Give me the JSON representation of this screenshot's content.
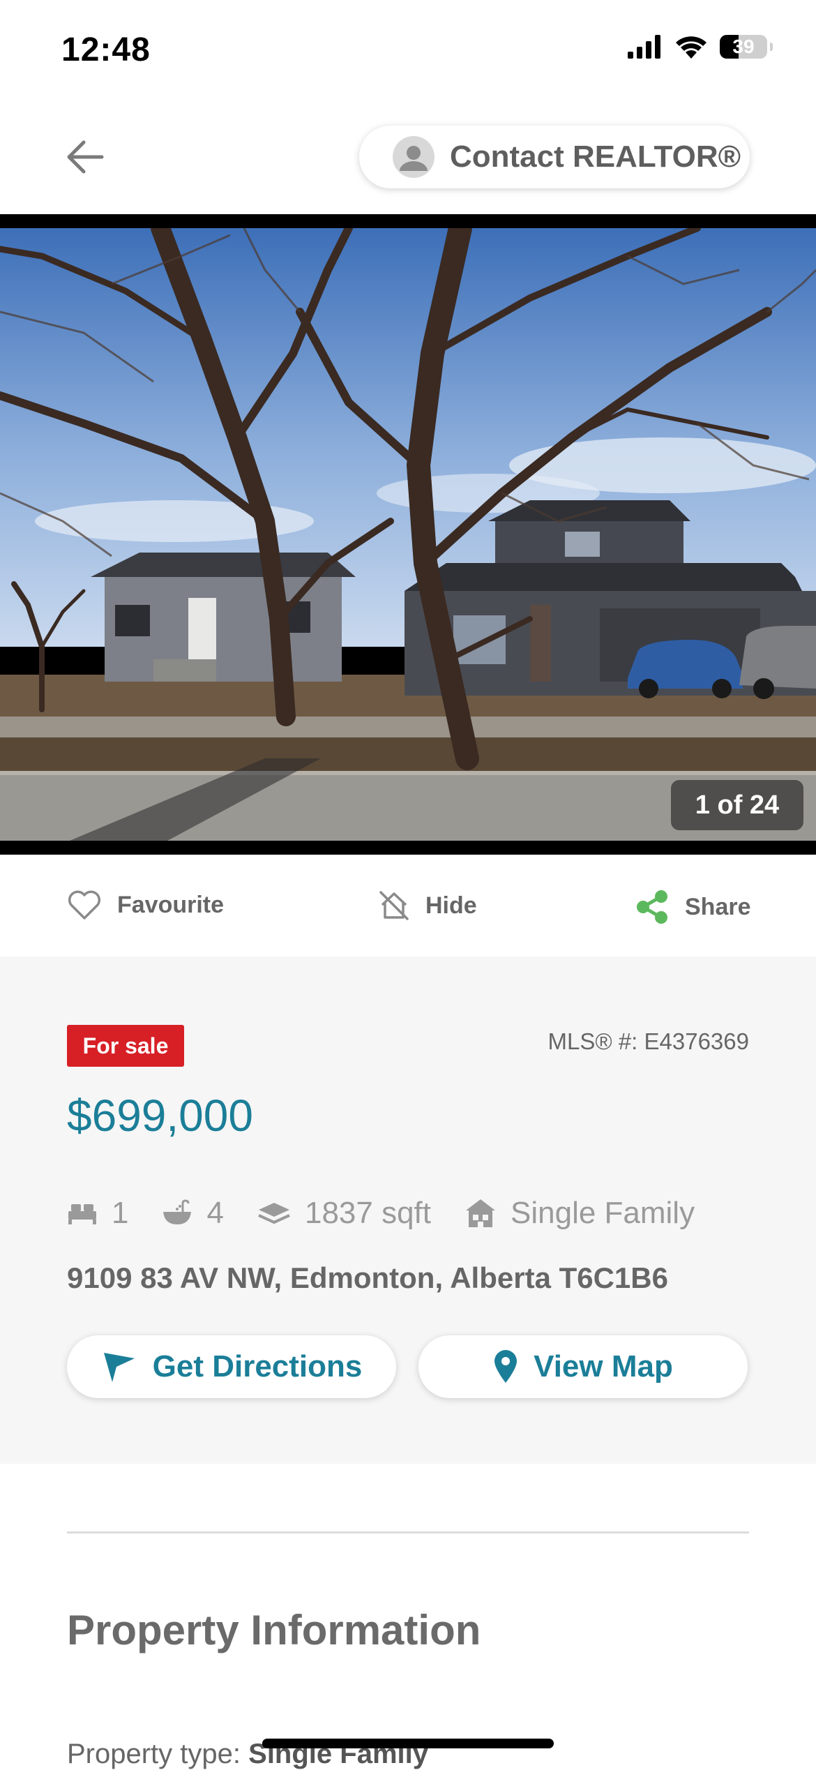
{
  "status_bar": {
    "time": "12:48",
    "battery": "39"
  },
  "nav": {
    "contact_label": "Contact REALTOR®"
  },
  "photo": {
    "counter": "1 of 24"
  },
  "actions": {
    "favourite": "Favourite",
    "hide": "Hide",
    "share": "Share"
  },
  "listing": {
    "status_badge": "For sale",
    "mls": "MLS® #: E4376369",
    "price": "$699,000",
    "bedrooms": "1",
    "bathrooms": "4",
    "size": "1837 sqft",
    "building_type": "Single Family",
    "address": "9109 83 AV NW, Edmonton, Alberta T6C1B6"
  },
  "buttons": {
    "directions": "Get Directions",
    "map": "View Map"
  },
  "section": {
    "title": "Property Information",
    "property_type_label": "Property type:",
    "property_type_value": "Single Family"
  },
  "colors": {
    "accent": "#1b7e98",
    "badge": "#d71f26",
    "share": "#5cb85c"
  }
}
